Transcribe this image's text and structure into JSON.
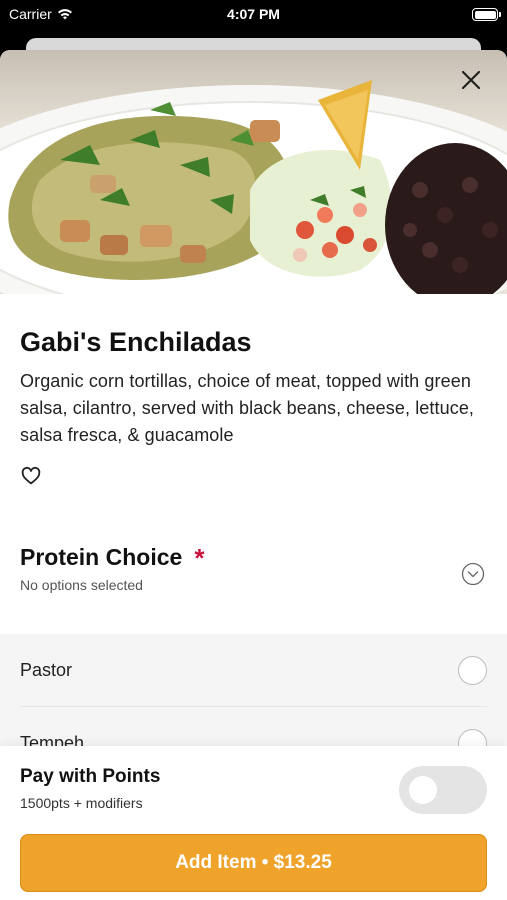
{
  "status_bar": {
    "carrier": "Carrier",
    "time": "4:07 PM"
  },
  "item": {
    "title": "Gabi's Enchiladas",
    "description": "Organic corn tortillas, choice of meat, topped with green salsa, cilantro, served with black beans, cheese, lettuce, salsa fresca, & guacamole"
  },
  "modifier_group": {
    "title": "Protein Choice",
    "required_mark": "*",
    "subtitle": "No options selected",
    "options": [
      {
        "label": "Pastor"
      },
      {
        "label": "Tempeh"
      }
    ]
  },
  "footer": {
    "points_title": "Pay with Points",
    "points_subtitle": "1500pts + modifiers",
    "add_button_label": "Add Item • $13.25"
  },
  "colors": {
    "accent": "#f0a32a",
    "required": "#c8103e"
  },
  "icons": [
    "wifi-icon",
    "battery-icon",
    "close-icon",
    "heart-icon",
    "chevron-down-icon"
  ]
}
